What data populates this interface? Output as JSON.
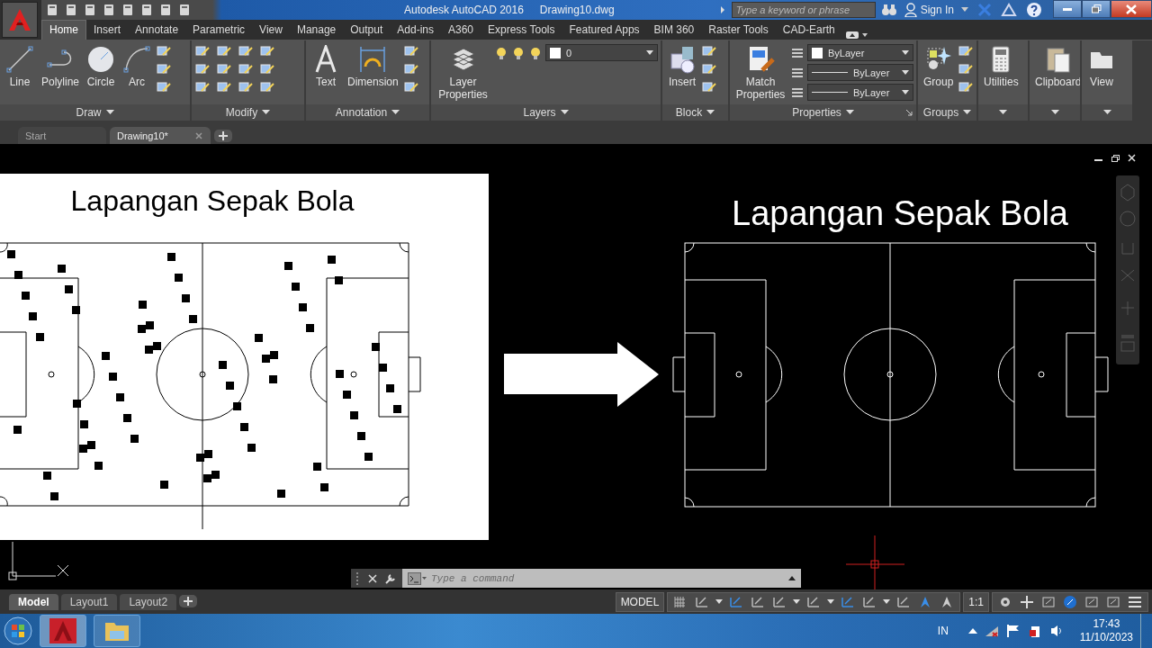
{
  "window": {
    "title": "Autodesk AutoCAD 2016",
    "document": "Drawing10.dwg"
  },
  "search": {
    "placeholder": "Type a keyword or phrase"
  },
  "account": {
    "label": "Sign In"
  },
  "ribbon_tabs": [
    {
      "label": "Home",
      "selected": true
    },
    {
      "label": "Insert",
      "selected": false
    },
    {
      "label": "Annotate",
      "selected": false
    },
    {
      "label": "Parametric",
      "selected": false
    },
    {
      "label": "View",
      "selected": false
    },
    {
      "label": "Manage",
      "selected": false
    },
    {
      "label": "Output",
      "selected": false
    },
    {
      "label": "Add-ins",
      "selected": false
    },
    {
      "label": "A360",
      "selected": false
    },
    {
      "label": "Express Tools",
      "selected": false
    },
    {
      "label": "Featured Apps",
      "selected": false
    },
    {
      "label": "BIM 360",
      "selected": false
    },
    {
      "label": "Raster Tools",
      "selected": false
    },
    {
      "label": "CAD-Earth",
      "selected": false
    }
  ],
  "panels": [
    {
      "title": "Draw",
      "tools": [
        {
          "kind": "large",
          "label": "Line"
        },
        {
          "kind": "large",
          "label": "Polyline"
        },
        {
          "kind": "large",
          "label": "Circle"
        },
        {
          "kind": "large",
          "label": "Arc"
        }
      ]
    },
    {
      "title": "Modify"
    },
    {
      "title": "Annotation",
      "tools": [
        {
          "kind": "large",
          "label": "Text"
        },
        {
          "kind": "large",
          "label": "Dimension"
        }
      ]
    },
    {
      "title": "Layers",
      "tools": [
        {
          "kind": "large",
          "label": "Layer Properties"
        },
        {
          "kind": "dropdown",
          "value": "0"
        }
      ]
    },
    {
      "title": "Block",
      "tools": [
        {
          "kind": "large",
          "label": "Insert"
        }
      ]
    },
    {
      "title": "Properties",
      "tools": [
        {
          "kind": "large",
          "label": "Match Properties"
        },
        {
          "kind": "dropdown",
          "value": "ByLayer"
        },
        {
          "kind": "dropdown",
          "value": "ByLayer"
        },
        {
          "kind": "dropdown",
          "value": "ByLayer"
        }
      ]
    },
    {
      "title": "Groups",
      "tools": [
        {
          "kind": "large",
          "label": "Group"
        }
      ]
    },
    {
      "tools": [
        {
          "kind": "large",
          "label": "Utilities"
        }
      ]
    },
    {
      "tools": [
        {
          "kind": "large",
          "label": "Clipboard"
        }
      ]
    },
    {
      "tools": [
        {
          "kind": "large",
          "label": "View"
        }
      ]
    }
  ],
  "file_tabs": [
    {
      "label": "Start",
      "selected": false
    },
    {
      "label": "Drawing10*",
      "selected": true
    }
  ],
  "drawing": {
    "left_title": "Lapangan Sepak Bola",
    "right_title": "Lapangan Sepak Bola"
  },
  "command_line": {
    "placeholder": "Type a command"
  },
  "layout_tabs": [
    {
      "label": "Model",
      "selected": true
    },
    {
      "label": "Layout1",
      "selected": false
    },
    {
      "label": "Layout2",
      "selected": false
    }
  ],
  "status_bar": {
    "space": "MODEL",
    "scale": "1:1"
  },
  "taskbar": {
    "language": "IN",
    "time": "17:43",
    "date": "11/10/2023"
  }
}
